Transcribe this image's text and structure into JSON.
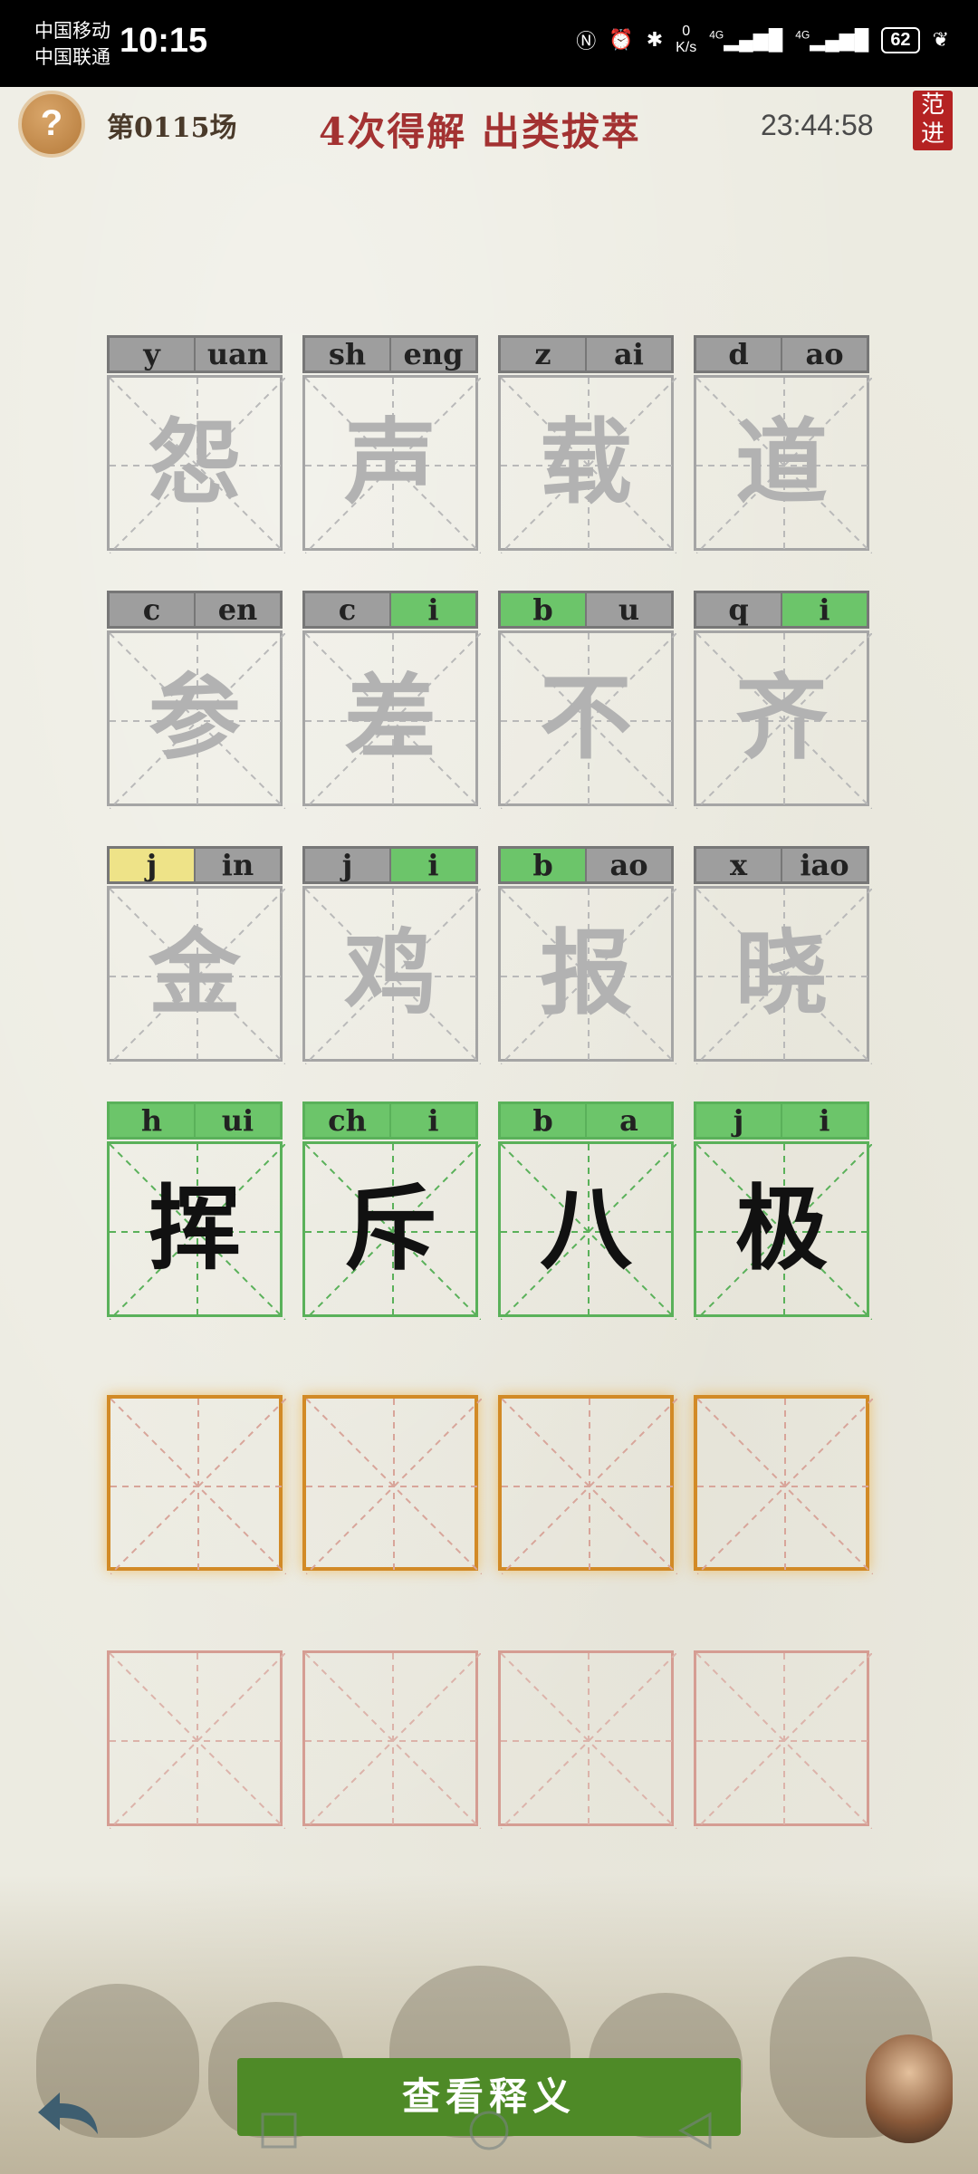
{
  "status_bar": {
    "carrier1": "中国移动",
    "carrier2": "中国联通",
    "time": "10:15",
    "net_speed_value": "0",
    "net_speed_unit": "K/s",
    "signal1": "4G",
    "signal2": "4G",
    "battery": "62"
  },
  "header": {
    "help_label": "?",
    "round": "第0115场",
    "title": "4次得解  出类拔萃",
    "timer": "23:44:58",
    "seal_text": "范进"
  },
  "tiles": [
    {
      "initial": "y",
      "final": "uan",
      "char": "怨",
      "ic": "",
      "fc": "",
      "solved": false
    },
    {
      "initial": "sh",
      "final": "eng",
      "char": "声",
      "ic": "",
      "fc": "",
      "solved": false
    },
    {
      "initial": "z",
      "final": "ai",
      "char": "载",
      "ic": "",
      "fc": "",
      "solved": false
    },
    {
      "initial": "d",
      "final": "ao",
      "char": "道",
      "ic": "",
      "fc": "",
      "solved": false
    },
    {
      "initial": "c",
      "final": "en",
      "char": "参",
      "ic": "",
      "fc": "",
      "solved": false
    },
    {
      "initial": "c",
      "final": "i",
      "char": "差",
      "ic": "",
      "fc": "green",
      "solved": false
    },
    {
      "initial": "b",
      "final": "u",
      "char": "不",
      "ic": "green",
      "fc": "",
      "solved": false
    },
    {
      "initial": "q",
      "final": "i",
      "char": "齐",
      "ic": "",
      "fc": "green",
      "solved": false
    },
    {
      "initial": "j",
      "final": "in",
      "char": "金",
      "ic": "yellow",
      "fc": "",
      "solved": false
    },
    {
      "initial": "j",
      "final": "i",
      "char": "鸡",
      "ic": "",
      "fc": "green",
      "solved": false
    },
    {
      "initial": "b",
      "final": "ao",
      "char": "报",
      "ic": "green",
      "fc": "",
      "solved": false
    },
    {
      "initial": "x",
      "final": "iao",
      "char": "晓",
      "ic": "",
      "fc": "",
      "solved": false
    },
    {
      "initial": "h",
      "final": "ui",
      "char": "挥",
      "ic": "green",
      "fc": "green",
      "solved": true
    },
    {
      "initial": "ch",
      "final": "i",
      "char": "斥",
      "ic": "green",
      "fc": "green",
      "solved": true
    },
    {
      "initial": "b",
      "final": "a",
      "char": "八",
      "ic": "green",
      "fc": "green",
      "solved": true
    },
    {
      "initial": "j",
      "final": "i",
      "char": "极",
      "ic": "green",
      "fc": "green",
      "solved": true
    }
  ],
  "bottom": {
    "view_button": "查看释义"
  },
  "colors": {
    "title_red": "#a33232",
    "hit_green": "#6cc56a",
    "partial_yellow": "#eee388",
    "miss_gray": "#9e9e9e",
    "button_green": "#4e8a27"
  }
}
